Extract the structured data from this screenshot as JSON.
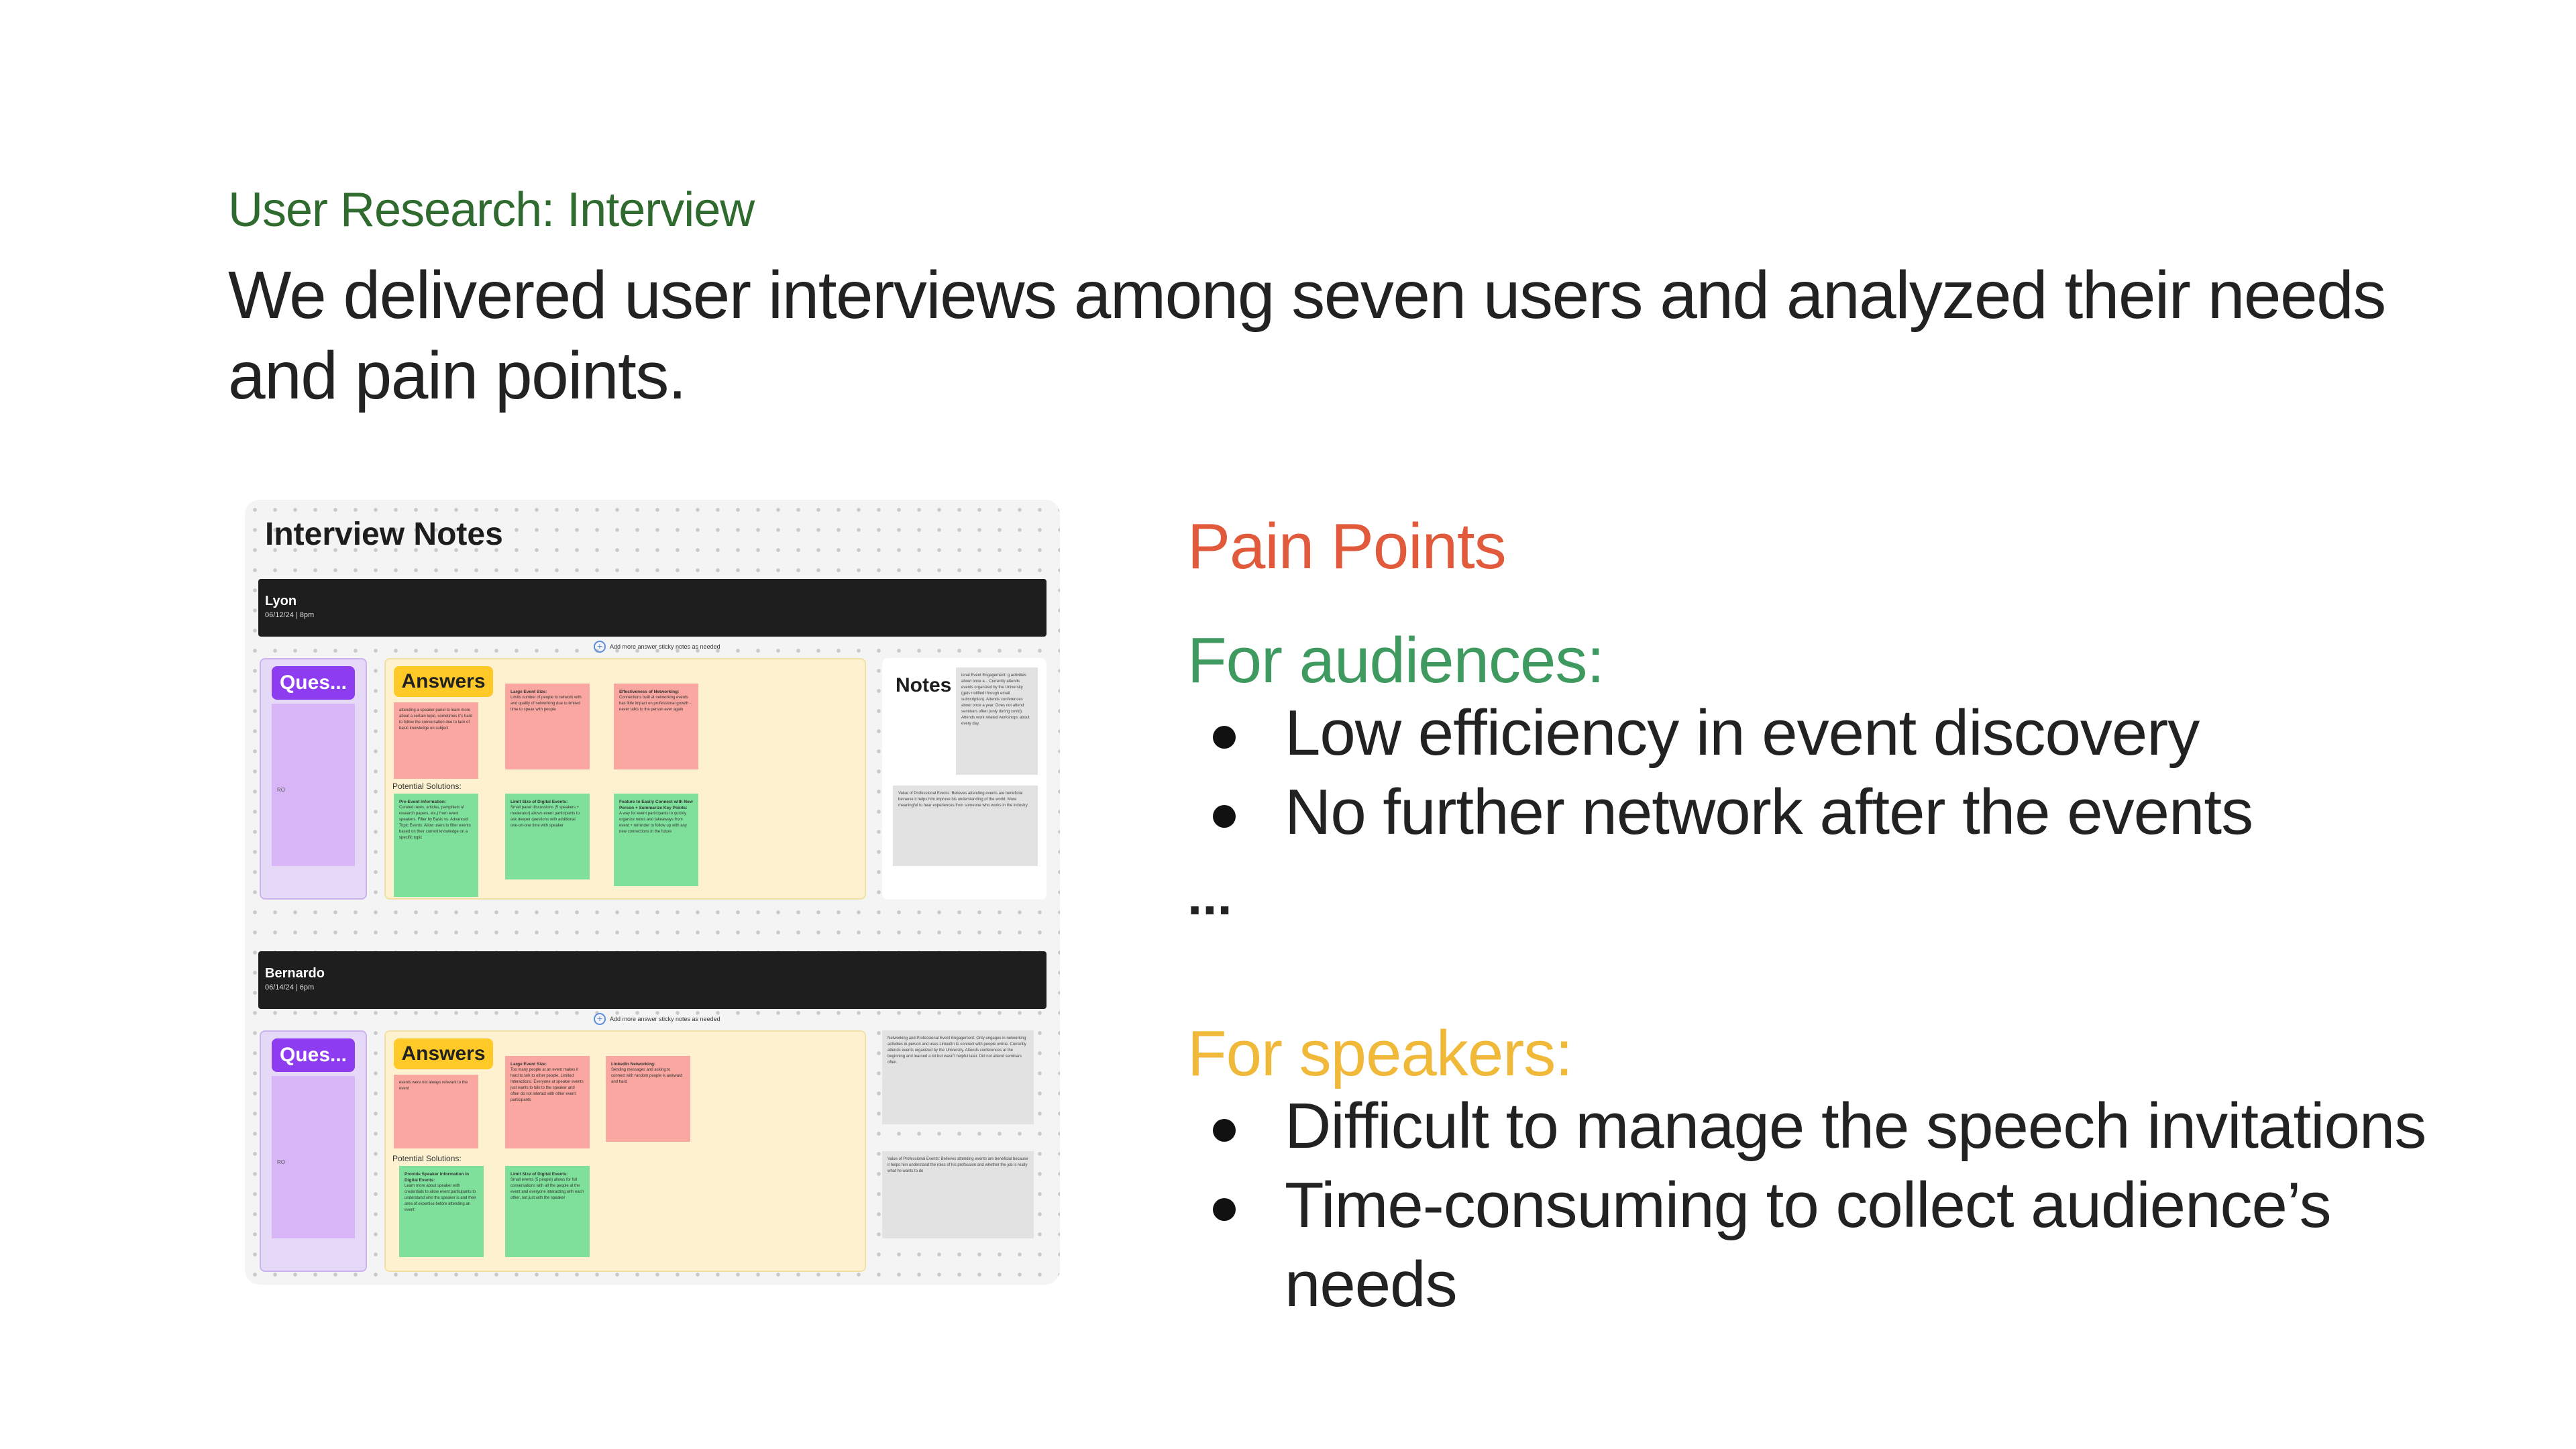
{
  "eyebrow": "User Research: Interview",
  "headline": "We delivered user interviews among seven users and analyzed their needs and pain points.",
  "board": {
    "title": "Interview Notes",
    "add_hint": "Add more answer sticky notes as needed",
    "questions_label": "Ques...",
    "answers_label": "Answers",
    "notes_label": "Notes",
    "potential_solutions_label": "Potential Solutions:",
    "sessions": [
      {
        "name": "Lyon",
        "date": "06/12/24 | 8pm",
        "q_note_2": "RO",
        "answers": [
          {
            "body": "attending a speaker panel to learn more about a certain topic, sometimes it's hard to follow the conversation due to lack of basic knowledge on subject"
          },
          {
            "head": "Large Event Size:",
            "body": "Limits number of people to network with and quality of networking due to limited time to speak with people"
          },
          {
            "head": "Effectiveness of Networking:",
            "body": "Connections built at networking events has little impact on professional growth - never talks to the person ever again"
          }
        ],
        "solutions": [
          {
            "head": "Pre-Event Information:",
            "body": "Curated news, articles, pamphlets of research papers, etc.) from event speakers. Filter by Basic vs. Advanced Topic Events: Allow users to filter events based on their current knowledge on a specific topic"
          },
          {
            "head": "Limit Size of Digital Events:",
            "body": "Small panel discussions (5 speakers + moderator) allows event participants to ask deeper questions with additional one-on-one time with speaker"
          },
          {
            "head": "Feature to Easily Connect with New Person + Summarize Key Points:",
            "body": "A way for event participants to quickly organize notes and takeaways from event + reminder to follow up with any new connections in the future"
          }
        ],
        "notes": [
          "ional Event Engagement: g activities about once a... Currently attends events organized by the University (gets notified through email subscription). Attends conferences about once a year. Does not attend seminars often (only during covid). Attends work related workshops about every day.",
          "Value of Professional Events: Believes attending events are beneficial because it helps him improve his understanding of the world. More meaningful to hear experiences from someone who works in the industry."
        ]
      },
      {
        "name": "Bernardo",
        "date": "06/14/24 | 6pm",
        "q_note_2": "RO",
        "answers": [
          {
            "body": "events were not always relevant to the event"
          },
          {
            "head": "Large Event Size:",
            "body": "Too many people at an event makes it hard to talk to other people. Limited Interactions: Everyone at speaker events just wants to talk to the speaker and often do not interact with other event participants"
          },
          {
            "head": "LinkedIn Networking:",
            "body": "Sending messages and asking to connect with random people is awkward and hard"
          }
        ],
        "solutions": [
          {
            "head": "Provide Speaker Information in Digital Events:",
            "body": "Learn more about speaker with credentials to allow event participants to understand who the speaker is and their area of expertise before attending an event"
          },
          {
            "head": "Limit Size of Digital Events:",
            "body": "Small events (5 people) allows for full conversations with all the people at the event and everyone interacting with each other, not just with the speaker"
          }
        ],
        "notes": [
          "Networking and Professional Event Engagement: Only engages in networking activities in-person and uses LinkedIn to connect with people online. Currently attends events organized by the University. Attends conferences at the beginning and learned a lot but wasn't helpful later. Did not attend seminars often.",
          "Value of Professional Events: Believes attending events are beneficial because it helps him understand the roles of his profession and whether the job is really what he wants to do"
        ]
      }
    ]
  },
  "pain_points": {
    "title": "Pain Points",
    "audiences": {
      "title": "For audiences:",
      "items": [
        "Low efficiency in event discovery",
        "No further network after the events"
      ],
      "more": "..."
    },
    "speakers": {
      "title": "For speakers:",
      "items": [
        "Difficult to manage the speech invitations",
        "Time-consuming to collect audience’s needs"
      ],
      "more": "..."
    }
  },
  "colors": {
    "eyebrow": "#2f6b2f",
    "pain_points": "#e15a3c",
    "audiences": "#3e9a5f",
    "speakers": "#f0b93a",
    "question_tag": "#8d3cf0",
    "answer_tag": "#ffc928",
    "pink_note": "#f9a7a0",
    "green_note": "#7ee09a"
  }
}
